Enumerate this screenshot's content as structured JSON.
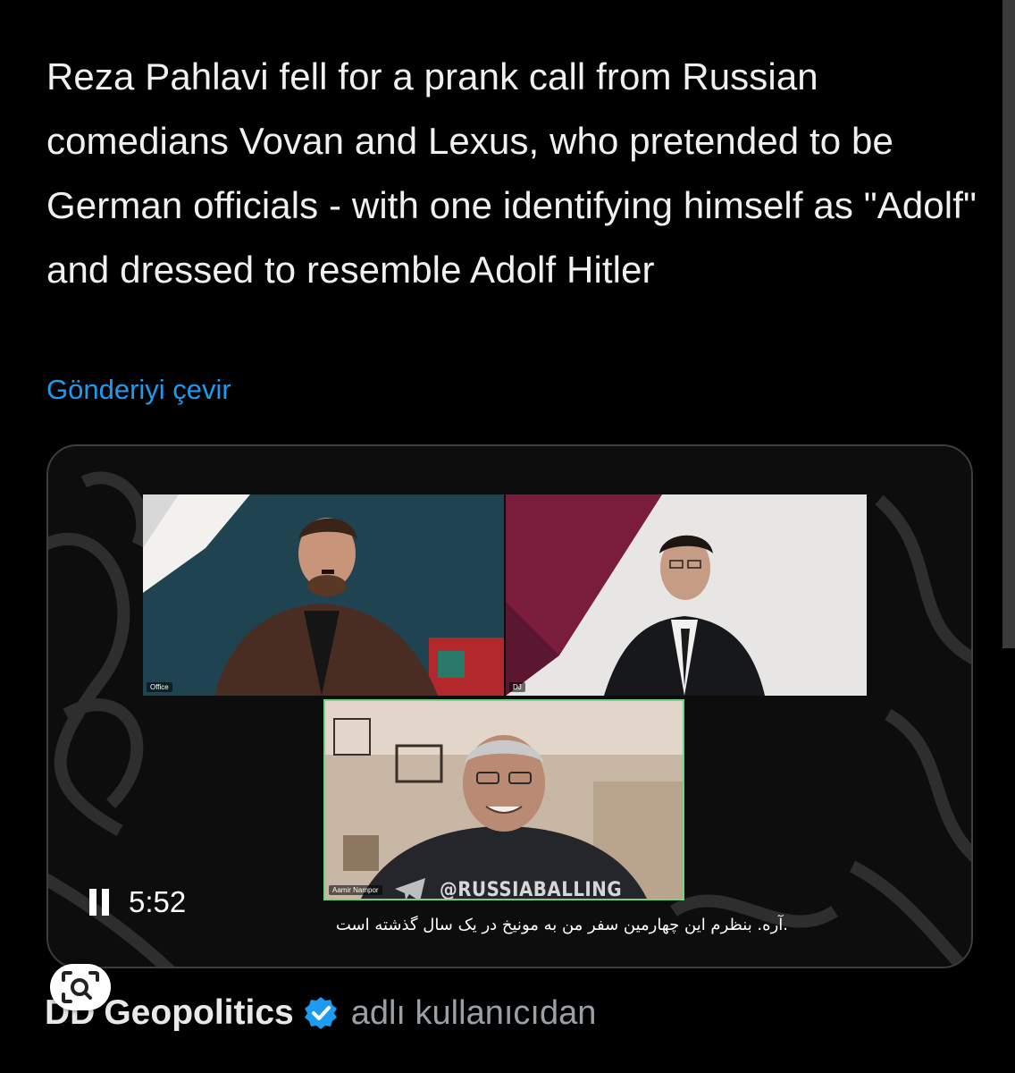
{
  "tweet": {
    "text": "Reza Pahlavi fell for a prank call from Russian comedians Vovan and Lexus, who pretended to be German officials - with one identifying himself as \"Adolf\" and dressed to resemble Adolf Hitler",
    "translate_label": "Gönderiyi çevir"
  },
  "video": {
    "time": "5:52",
    "watermark": "@RUSSIABALLING",
    "subtitle": ".آره. بنظرم این چهارمین سفر من به مونیخ در یک سال گذشته است",
    "participants": [
      "Office",
      "DJ",
      "Aamir Nampor"
    ]
  },
  "author": {
    "prefix": "DD",
    "name": "Geopolitics",
    "suffix": "adlı kullanıcıdan",
    "verified_color": "#1d9bf0"
  },
  "icons": [
    "pause-icon",
    "verified-badge-icon",
    "lens-search-icon",
    "telegram-icon"
  ]
}
